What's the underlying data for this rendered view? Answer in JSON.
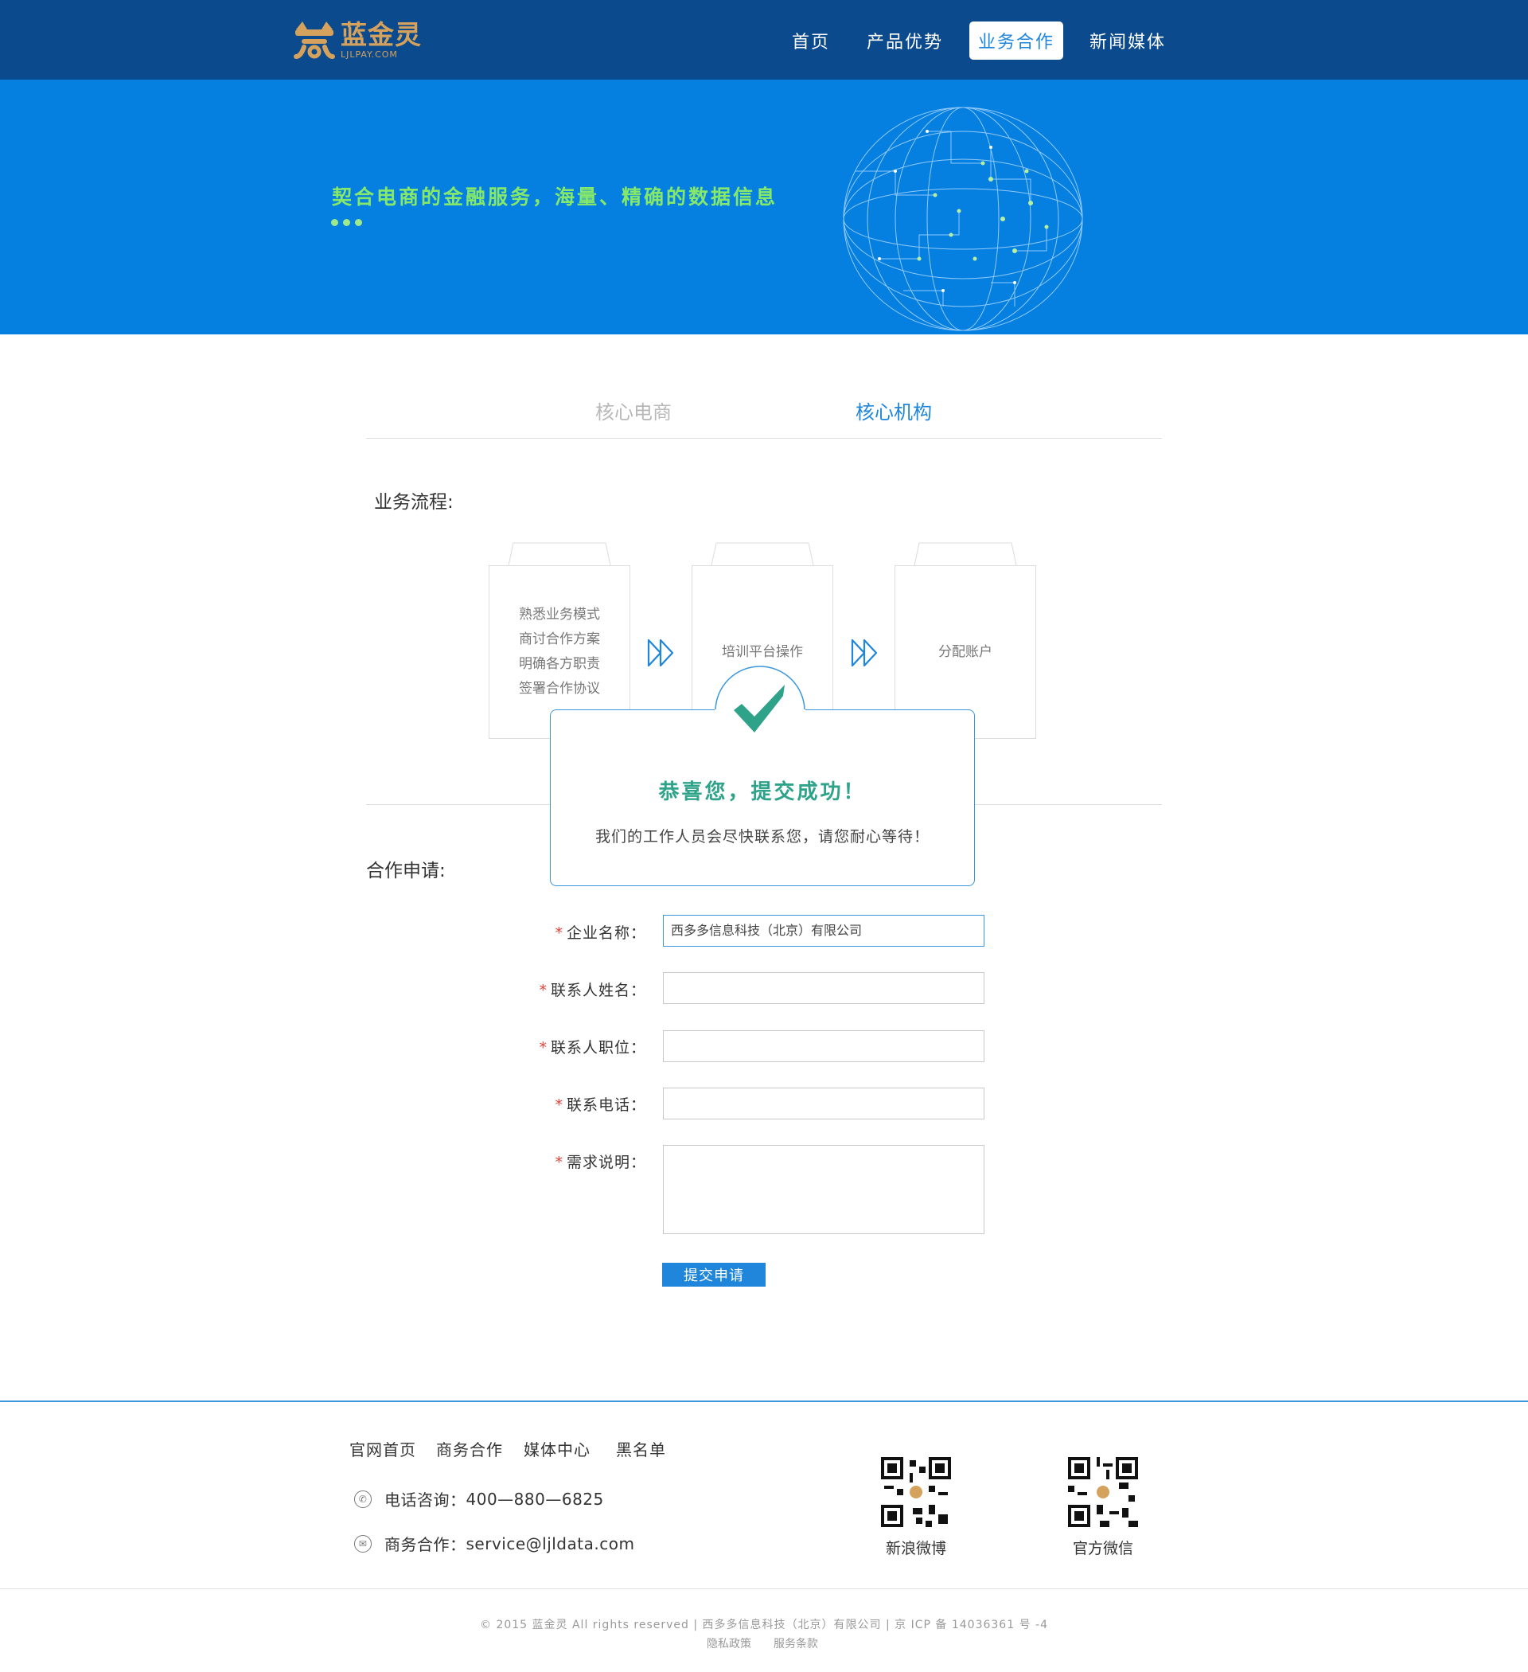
{
  "brand": {
    "name_cn": "蓝金灵",
    "name_en": "LJLPAY.COM",
    "color": "#d4a25c"
  },
  "nav": [
    {
      "label": "首页"
    },
    {
      "label": "产品优势"
    },
    {
      "label": "业务合作",
      "active": true
    },
    {
      "label": "新闻媒体"
    }
  ],
  "banner": {
    "slogan": "契合电商的金融服务，海量、精确的数据信息",
    "bg": "#0580e0"
  },
  "tabs": [
    {
      "label": "核心电商",
      "active": false
    },
    {
      "label": "核心机构",
      "active": true
    }
  ],
  "process": {
    "title": "业务流程:",
    "steps": [
      {
        "lines": [
          "熟悉业务模式",
          "商讨合作方案",
          "明确各方职责",
          "签署合作协议"
        ]
      },
      {
        "lines": [
          "培训平台操作"
        ]
      },
      {
        "lines": [
          "分配账户"
        ]
      }
    ],
    "arrow_icon": "double-chevron-right-icon"
  },
  "modal": {
    "title": "恭喜您，提交成功！",
    "message": "我们的工作人员会尽快联系您，请您耐心等待！",
    "icon": "checkmark-icon",
    "accent": "#2fa38a"
  },
  "form": {
    "title": "合作申请:",
    "required_mark": "*",
    "fields": [
      {
        "label": "企业名称：",
        "value": "西多多信息科技（北京）有限公司"
      },
      {
        "label": "联系人姓名：",
        "value": ""
      },
      {
        "label": "联系人职位：",
        "value": ""
      },
      {
        "label": "联系电话：",
        "value": ""
      },
      {
        "label": "需求说明：",
        "value": ""
      }
    ],
    "submit_label": "提交申请"
  },
  "footer": {
    "links": [
      "官网首页",
      "商务合作",
      "媒体中心",
      "黑名单"
    ],
    "phone_label": "电话咨询：",
    "phone": "400—880—6825",
    "biz_label": "商务合作：",
    "email": "service@ljldata.com",
    "qr": [
      {
        "label": "新浪微博"
      },
      {
        "label": "官方微信"
      }
    ],
    "copyright": "© 2015 蓝金灵 All rights reserved | 西多多信息科技（北京）有限公司 | 京 ICP 备 14036361 号 -4",
    "policy_links": [
      "隐私政策",
      "服务条款"
    ]
  }
}
